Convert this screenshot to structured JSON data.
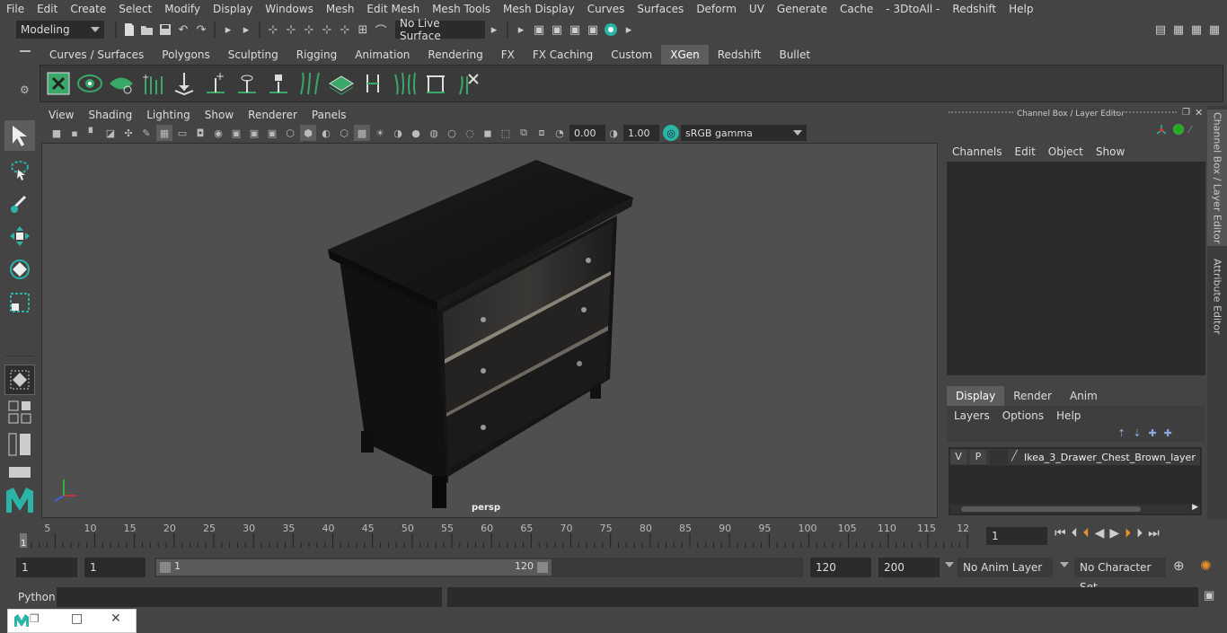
{
  "menubar": {
    "items": [
      "File",
      "Edit",
      "Create",
      "Select",
      "Modify",
      "Display",
      "Windows",
      "Mesh",
      "Edit Mesh",
      "Mesh Tools",
      "Mesh Display",
      "Curves",
      "Surfaces",
      "Deform",
      "UV",
      "Generate",
      "Cache",
      "- 3DtoAll -",
      "Redshift",
      "Help"
    ]
  },
  "statusline": {
    "mode": "Modeling",
    "live_surface": "No Live Surface"
  },
  "shelf": {
    "tabs": [
      "Curves / Surfaces",
      "Polygons",
      "Sculpting",
      "Rigging",
      "Animation",
      "Rendering",
      "FX",
      "FX Caching",
      "Custom",
      "XGen",
      "Redshift",
      "Bullet"
    ],
    "active_tab": "XGen"
  },
  "viewport": {
    "menu": [
      "View",
      "Shading",
      "Lighting",
      "Show",
      "Renderer",
      "Panels"
    ],
    "exposure": "0.00",
    "gamma": "1.00",
    "color_space": "sRGB gamma",
    "camera_label": "persp"
  },
  "channel_box": {
    "title": "Channel Box / Layer Editor",
    "menu": [
      "Channels",
      "Edit",
      "Object",
      "Show"
    ],
    "layer_tabs": [
      "Display",
      "Render",
      "Anim"
    ],
    "active_layer_tab": "Display",
    "layer_menu": [
      "Layers",
      "Options",
      "Help"
    ],
    "layer": {
      "visible": "V",
      "playback": "P",
      "name": "Ikea_3_Drawer_Chest_Brown_layer"
    }
  },
  "side_tabs": [
    "Channel Box / Layer Editor",
    "Attribute Editor"
  ],
  "timeline": {
    "ticks": [
      "5",
      "10",
      "15",
      "20",
      "25",
      "30",
      "35",
      "40",
      "45",
      "50",
      "55",
      "60",
      "65",
      "70",
      "75",
      "80",
      "85",
      "90",
      "95",
      "100",
      "105",
      "110",
      "115",
      "12"
    ],
    "start_marker": "1",
    "current_frame": "1"
  },
  "range": {
    "start_frame": "1",
    "playback_start": "1",
    "slider_start": "1",
    "slider_end": "120",
    "playback_end": "120",
    "end_frame": "200",
    "anim_layer": "No Anim Layer",
    "character_set": "No Character Set"
  },
  "cmdline": {
    "language": "Python"
  },
  "colors": {
    "active_tab": "#5d5d5d",
    "panel_bg": "#444444",
    "field_bg": "#2b2b2b",
    "accent_teal": "#2bb3a6",
    "shelf_green": "#3aa869"
  }
}
